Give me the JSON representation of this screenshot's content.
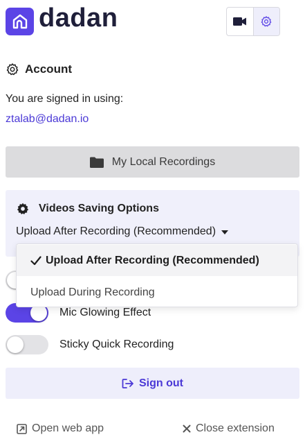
{
  "header": {
    "logo_text": "dadan",
    "camera_icon": "video-camera-icon",
    "settings_icon": "gear-icon"
  },
  "account": {
    "title": "Account",
    "signed_in_label": "You are signed in using:",
    "email": "ztalab@dadan.io"
  },
  "recordings_button": {
    "label": "My Local Recordings",
    "icon": "folder-icon"
  },
  "saving_options": {
    "title": "Videos Saving Options",
    "selected": "Upload After Recording (Recommended)",
    "options": [
      {
        "label": "Upload After Recording (Recommended)",
        "selected": true
      },
      {
        "label": "Upload During Recording",
        "selected": false
      }
    ]
  },
  "toggles": [
    {
      "label": "Mic Glowing Effect",
      "on": true
    },
    {
      "label": "Sticky Quick Recording",
      "on": false
    }
  ],
  "signout": {
    "label": "Sign out",
    "icon": "sign-out-icon"
  },
  "footer": {
    "open_web_app": "Open web app",
    "close_extension": "Close extension"
  },
  "colors": {
    "accent": "#5b44e6",
    "link": "#4b39d6",
    "panel_bg": "#f0f0fb",
    "button_gray": "#dcdcde"
  }
}
